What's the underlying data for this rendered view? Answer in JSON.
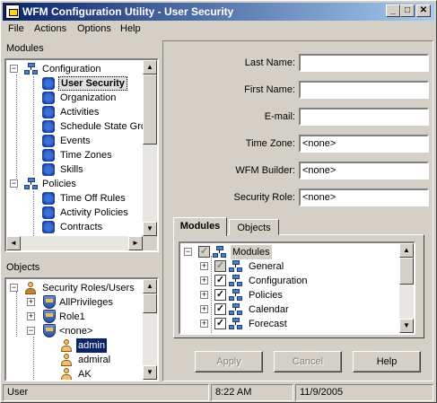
{
  "window": {
    "title": "WFM Configuration Utility - User Security",
    "minimize": "_",
    "maximize": "□",
    "close": "✕"
  },
  "menu": {
    "file": "File",
    "actions": "Actions",
    "options": "Options",
    "help": "Help"
  },
  "modules_panel": {
    "header": "Modules",
    "tree": [
      {
        "label": "Configuration",
        "icon": "network-icon",
        "expander": "−"
      },
      {
        "label": "User Security",
        "icon": "puzzle-icon",
        "selected": true
      },
      {
        "label": "Organization",
        "icon": "puzzle-icon"
      },
      {
        "label": "Activities",
        "icon": "puzzle-icon"
      },
      {
        "label": "Schedule State Gro",
        "icon": "puzzle-icon"
      },
      {
        "label": "Events",
        "icon": "puzzle-icon"
      },
      {
        "label": "Time Zones",
        "icon": "puzzle-icon"
      },
      {
        "label": "Skills",
        "icon": "puzzle-icon"
      },
      {
        "label": "Policies",
        "icon": "network-icon",
        "expander": "−"
      },
      {
        "label": "Time Off Rules",
        "icon": "puzzle-icon"
      },
      {
        "label": "Activity Policies",
        "icon": "puzzle-icon"
      },
      {
        "label": "Contracts",
        "icon": "puzzle-icon"
      }
    ]
  },
  "objects_panel": {
    "header": "Objects",
    "tree": [
      {
        "label": "Security Roles/Users",
        "icon": "people-icon",
        "expander": "−"
      },
      {
        "label": "AllPrivileges",
        "icon": "shield-icon",
        "expander": "+"
      },
      {
        "label": "Role1",
        "icon": "shield-icon",
        "expander": "+"
      },
      {
        "label": "<none>",
        "icon": "shield-icon",
        "expander": "−"
      },
      {
        "label": "admin",
        "icon": "person-icon",
        "selected": true
      },
      {
        "label": "admiral",
        "icon": "person-icon"
      },
      {
        "label": "AK",
        "icon": "person-icon"
      }
    ]
  },
  "form": {
    "last_name_label": "Last Name:",
    "last_name_value": "",
    "first_name_label": "First Name:",
    "first_name_value": "",
    "email_label": "E-mail:",
    "email_value": "",
    "time_zone_label": "Time Zone:",
    "time_zone_value": "<none>",
    "wfm_builder_label": "WFM Builder:",
    "wfm_builder_value": "<none>",
    "security_role_label": "Security Role:",
    "security_role_value": "<none>"
  },
  "tabs": {
    "modules": "Modules",
    "objects": "Objects"
  },
  "module_tree": [
    {
      "label": "Modules",
      "checked": true,
      "grey": true,
      "expander": "−"
    },
    {
      "label": "General",
      "checked": true,
      "grey": true,
      "expander": "+"
    },
    {
      "label": "Configuration",
      "checked": true,
      "expander": "+"
    },
    {
      "label": "Policies",
      "checked": true,
      "expander": "+"
    },
    {
      "label": "Calendar",
      "checked": true,
      "expander": "+"
    },
    {
      "label": "Forecast",
      "checked": true,
      "expander": "+"
    }
  ],
  "buttons": {
    "apply": "Apply",
    "cancel": "Cancel",
    "help": "Help"
  },
  "status": {
    "user": "User",
    "time": "8:22 AM",
    "date": "11/9/2005"
  }
}
